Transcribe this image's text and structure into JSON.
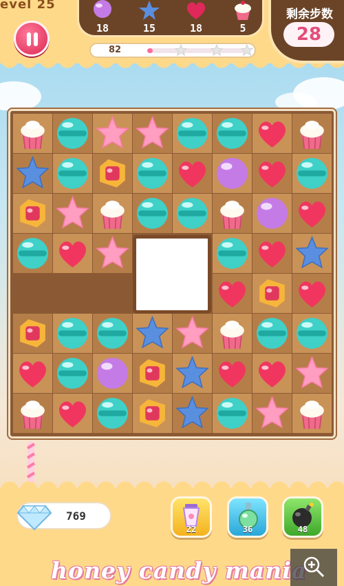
{
  "header": {
    "level_label": "evel 25",
    "moves_label": "剩余步数",
    "moves_count": "28",
    "score": "82",
    "score_progress": 0.05
  },
  "goals": [
    {
      "piece": "purple-candy",
      "count": "18"
    },
    {
      "piece": "blue-star",
      "count": "15"
    },
    {
      "piece": "red-heart",
      "count": "18"
    },
    {
      "piece": "cupcake",
      "count": "5"
    }
  ],
  "board": {
    "rows": 8,
    "cols": 8,
    "grid": [
      [
        "cupcake",
        "teal",
        "pink-star",
        "pink-star",
        "teal",
        "teal",
        "red-heart",
        "cupcake"
      ],
      [
        "blue-star",
        "teal",
        "wrapped",
        "teal",
        "red-heart",
        "purple",
        "red-heart",
        "teal"
      ],
      [
        "wrapped",
        "pink-star",
        "cupcake",
        "teal",
        "teal",
        "cupcake",
        "purple",
        "red-heart"
      ],
      [
        "teal",
        "red-heart",
        "pink-star",
        "blocker",
        "blocker",
        "teal",
        "red-heart",
        "blue-star"
      ],
      [
        "empty",
        "empty",
        "empty",
        "blocker",
        "blocker",
        "red-heart",
        "wrapped",
        "red-heart"
      ],
      [
        "wrapped",
        "teal",
        "teal",
        "blue-star",
        "pink-star",
        "cupcake",
        "teal",
        "teal"
      ],
      [
        "red-heart",
        "teal",
        "purple",
        "wrapped",
        "blue-star",
        "red-heart",
        "red-heart",
        "pink-star"
      ],
      [
        "cupcake",
        "red-heart",
        "teal",
        "wrapped",
        "blue-star",
        "teal",
        "pink-star",
        "cupcake"
      ]
    ]
  },
  "footer": {
    "gem_count": "769",
    "boosters": [
      {
        "name": "shake-booster",
        "count": "22"
      },
      {
        "name": "potion-booster",
        "count": "36"
      },
      {
        "name": "bomb-booster",
        "count": "48"
      }
    ],
    "title": "honey candy mania"
  },
  "colors": {
    "teal": "#3fd0c8",
    "pink-star": "#ff9ec0",
    "blue-star": "#5a8fe0",
    "red-heart": "#f0365e",
    "purple": "#c57be6",
    "wrapped": "#f7b53a"
  }
}
